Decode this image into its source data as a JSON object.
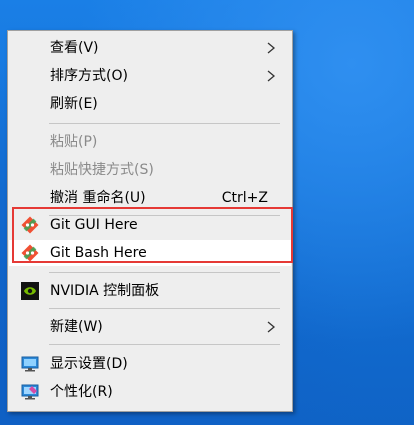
{
  "context_menu": {
    "items": [
      {
        "label": "查看(V)",
        "has_submenu": true,
        "enabled": true
      },
      {
        "label": "排序方式(O)",
        "has_submenu": true,
        "enabled": true
      },
      {
        "label": "刷新(E)",
        "enabled": true
      },
      {
        "label": "粘贴(P)",
        "enabled": false
      },
      {
        "label": "粘贴快捷方式(S)",
        "enabled": false
      },
      {
        "label": "撤消 重命名(U)",
        "shortcut": "Ctrl+Z",
        "enabled": true
      },
      {
        "label": "Git GUI Here",
        "icon": "git-icon",
        "enabled": true
      },
      {
        "label": "Git Bash Here",
        "icon": "git-icon",
        "enabled": true,
        "hovered": true
      },
      {
        "label": "NVIDIA 控制面板",
        "icon": "nvidia-icon",
        "enabled": true
      },
      {
        "label": "新建(W)",
        "has_submenu": true,
        "enabled": true
      },
      {
        "label": "显示设置(D)",
        "icon": "display-settings-icon",
        "enabled": true
      },
      {
        "label": "个性化(R)",
        "icon": "personalize-icon",
        "enabled": true
      }
    ]
  },
  "colors": {
    "menu_background": "#eeeeee",
    "hover_background": "#ffffff",
    "disabled_text": "#8a8a8a",
    "highlight_box": "#e53935",
    "desktop": "#1976d2"
  }
}
